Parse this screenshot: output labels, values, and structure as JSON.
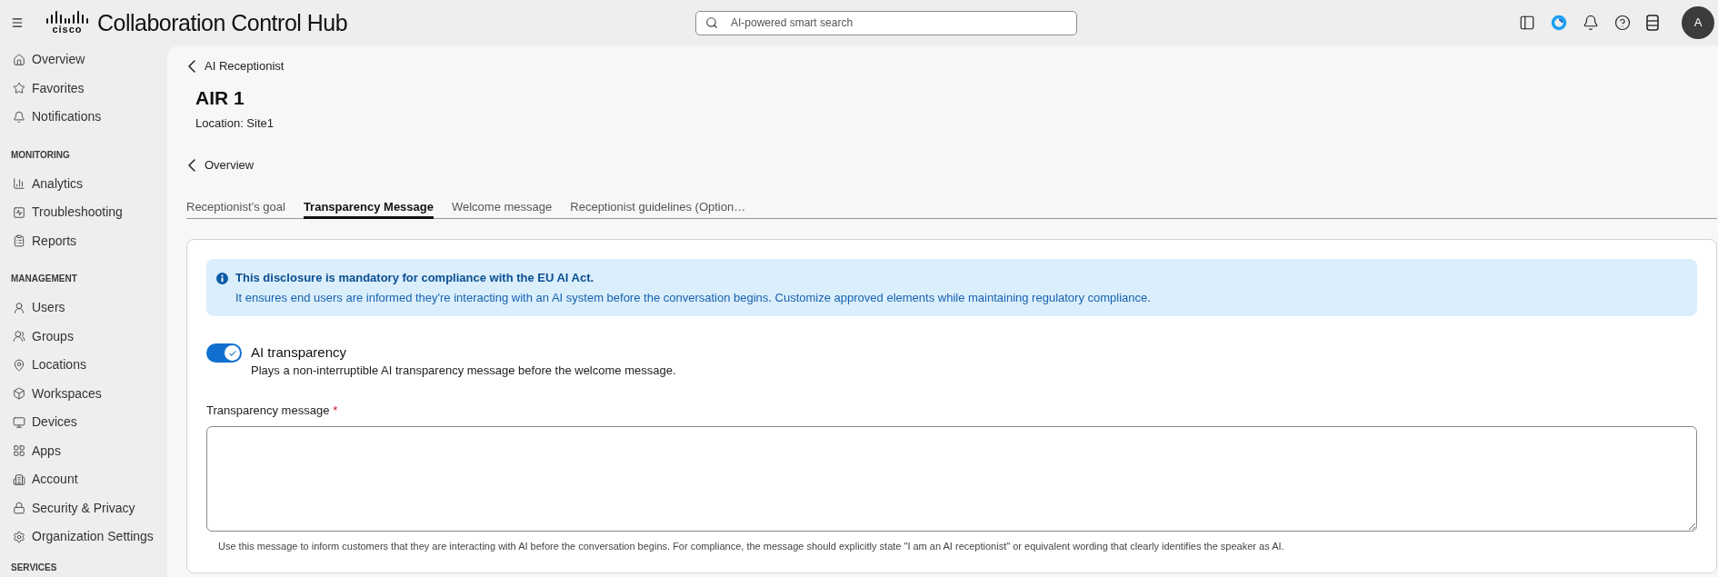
{
  "header": {
    "logo_text": "cisco",
    "title": "Collaboration Control Hub",
    "search": {
      "placeholder": "AI-powered smart search"
    },
    "avatar": "A"
  },
  "sidebar": {
    "sections": [
      {
        "items": [
          {
            "label": "Overview",
            "selected": false
          },
          {
            "label": "Favorites",
            "selected": false
          },
          {
            "label": "Notifications",
            "selected": false
          }
        ]
      },
      {
        "heading": "MONITORING",
        "items": [
          {
            "label": "Analytics",
            "selected": false
          },
          {
            "label": "Troubleshooting",
            "selected": false
          },
          {
            "label": "Reports",
            "selected": false
          }
        ]
      },
      {
        "heading": "MANAGEMENT",
        "items": [
          {
            "label": "Users",
            "selected": false
          },
          {
            "label": "Groups",
            "selected": false
          },
          {
            "label": "Locations",
            "selected": false
          },
          {
            "label": "Workspaces",
            "selected": false
          },
          {
            "label": "Devices",
            "selected": false
          },
          {
            "label": "Apps",
            "selected": false
          },
          {
            "label": "Account",
            "selected": false
          },
          {
            "label": "Security & Privacy",
            "selected": false
          },
          {
            "label": "Organization Settings",
            "selected": false
          }
        ]
      },
      {
        "heading": "SERVICES"
      }
    ]
  },
  "main": {
    "back_link": "AI Receptionist",
    "title": "AIR 1",
    "location": "Location: Site1",
    "section_link": "Overview",
    "tabs": [
      {
        "label": "Receptionist’s goal",
        "selected": false
      },
      {
        "label": "Transparency Message",
        "selected": true
      },
      {
        "label": "Welcome message",
        "selected": false
      },
      {
        "label": "Receptionist guidelines (Option…",
        "selected": false
      }
    ],
    "card": {
      "banner": {
        "title": "This disclosure is mandatory for compliance with the EU AI Act.",
        "text": "It ensures end users are informed they're interacting with an AI system before the conversation begins. Customize approved elements while maintaining regulatory compliance."
      },
      "toggle": {
        "label": "AI transparency",
        "description": "Plays a non-interruptible AI transparency message before the welcome message.",
        "on": true
      },
      "field": {
        "label": "Transparency message",
        "required_mark": "*",
        "hint": "Use this message to inform customers that they are interacting with AI before the conversation begins. For compliance, the message should explicitly state \"I am an AI receptionist\" or equivalent wording that clearly identifies the speaker as AI."
      }
    }
  }
}
